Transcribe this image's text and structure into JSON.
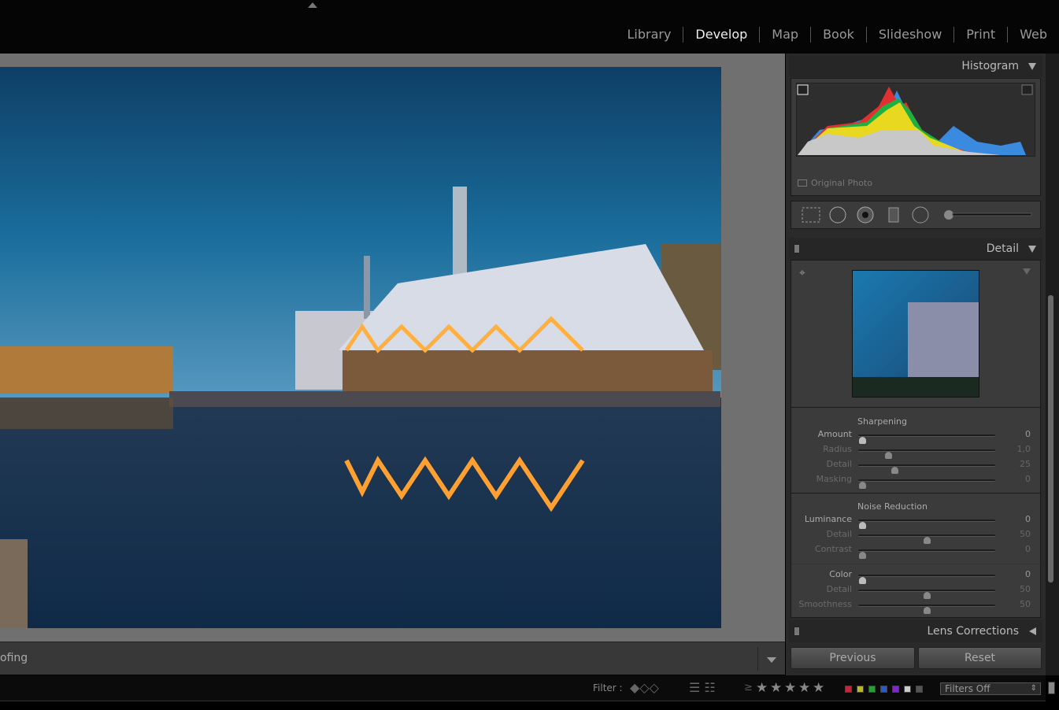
{
  "modules": [
    "Library",
    "Develop",
    "Map",
    "Book",
    "Slideshow",
    "Print",
    "Web"
  ],
  "active_module": "Develop",
  "toolbar": {
    "soft_proofing_label": "ofing"
  },
  "histogram": {
    "title": "Histogram",
    "original_photo_label": "Original Photo"
  },
  "tools": [
    "crop-overlay",
    "spot-removal",
    "red-eye",
    "graduated-filter",
    "radial-filter",
    "adjustment-brush"
  ],
  "detail": {
    "title": "Detail",
    "sharpening": {
      "title": "Sharpening",
      "sliders": [
        {
          "label": "Amount",
          "value": "0",
          "pos": 0,
          "hi": true
        },
        {
          "label": "Radius",
          "value": "1,0",
          "pos": 0.2
        },
        {
          "label": "Detail",
          "value": "25",
          "pos": 0.25
        },
        {
          "label": "Masking",
          "value": "0",
          "pos": 0
        }
      ]
    },
    "noise_reduction": {
      "title": "Noise Reduction",
      "sliders": [
        {
          "label": "Luminance",
          "value": "0",
          "pos": 0,
          "hi": true
        },
        {
          "label": "Detail",
          "value": "50",
          "pos": 0.5
        },
        {
          "label": "Contrast",
          "value": "0",
          "pos": 0
        }
      ]
    },
    "color": {
      "sliders": [
        {
          "label": "Color",
          "value": "0",
          "pos": 0,
          "hi": true
        },
        {
          "label": "Detail",
          "value": "50",
          "pos": 0.5
        },
        {
          "label": "Smoothness",
          "value": "50",
          "pos": 0.5
        }
      ]
    }
  },
  "lens_corrections": {
    "title": "Lens Corrections"
  },
  "buttons": {
    "previous": "Previous",
    "reset": "Reset"
  },
  "filmstrip": {
    "filter_label": "Filter :",
    "rating_op": "≥",
    "stars": 5,
    "color_labels": [
      "#c0283a",
      "#b8b82a",
      "#2a9a3a",
      "#2a5ac0",
      "#7a2ac0",
      "#cccccc",
      "#555555"
    ],
    "filters_select": "Filters Off"
  }
}
